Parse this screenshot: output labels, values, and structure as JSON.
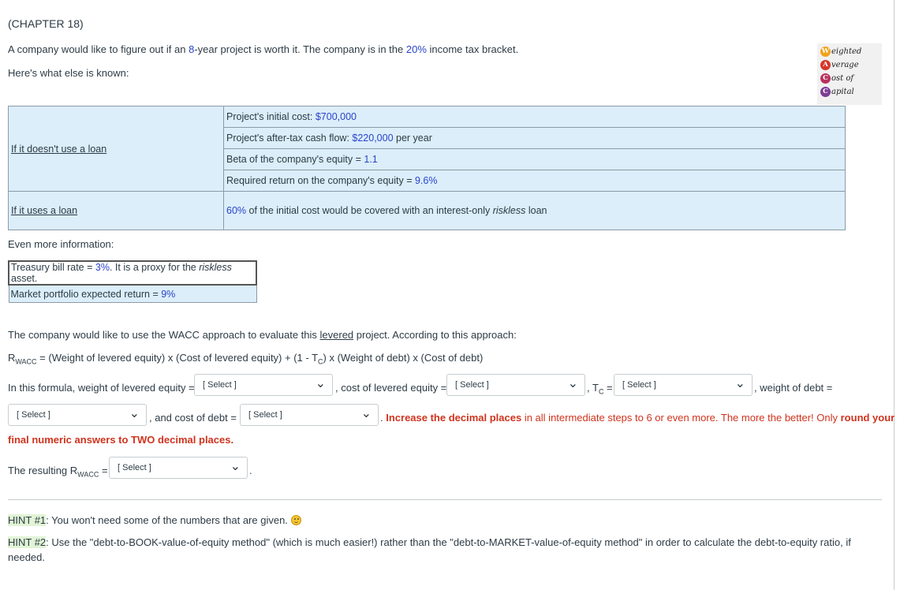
{
  "chapter": "(CHAPTER 18)",
  "intro": {
    "p1_a": "A company would like to figure out if an ",
    "years": "8",
    "p1_b": "-year project is worth it. The company is in the ",
    "tax": "20%",
    "p1_c": " income tax bracket.",
    "p2": "Here's what else is known:"
  },
  "logo": {
    "letters": [
      "W",
      "A",
      "C",
      "C"
    ],
    "words": [
      "eighted",
      "verage",
      "ost of",
      "apital"
    ],
    "colors": [
      "#f2a31b",
      "#d6372b",
      "#b8325f",
      "#7e3c94"
    ]
  },
  "table": {
    "no_loan_label": "If it doesn't use a loan",
    "rows": [
      {
        "pre": "Project's initial cost: ",
        "val": "$700,000",
        "post": ""
      },
      {
        "pre": "Project's after-tax cash flow: ",
        "val": "$220,000",
        "post": " per year"
      },
      {
        "pre": "Beta of the company's equity = ",
        "val": "1.1",
        "post": ""
      },
      {
        "pre": "Required return on the company's equity = ",
        "val": "9.6%",
        "post": ""
      }
    ],
    "loan_label": "If it uses a loan",
    "loan_val": "60%",
    "loan_text": " of the initial cost would be covered with an interest-only ",
    "loan_ital": "riskless",
    "loan_end": " loan"
  },
  "more": {
    "heading": "Even more information:",
    "tbill_pre": "Treasury bill rate = ",
    "tbill_val": "3%",
    "tbill_post": ". It is a proxy for the ",
    "tbill_ital": "riskless",
    "tbill_end": " asset.",
    "market_pre": "Market portfolio expected return = ",
    "market_val": "9%"
  },
  "wacc": {
    "p1_a": "The company would like to use the WACC approach to evaluate this ",
    "levered": "levered",
    "p1_b": " project. According to this approach:",
    "formula_r": "R",
    "formula_sub": "WACC",
    "formula_a": " = (Weight of levered equity) x (Cost of levered equity) + (1 - T",
    "formula_tsub": "C",
    "formula_b": ") x (Weight of debt) x (Cost of debt)",
    "f1": "In this formula, weight of levered equity = ",
    "f2": ", cost of levered equity = ",
    "f3": ", T",
    "f3_sub": "C",
    "f3_eq": " = ",
    "f4": ", weight of debt =",
    "f5": ", and cost of debt = ",
    "f6": ". ",
    "inc": "Increase the decimal places",
    "inc_rest": " in all intermediate steps to 6 or even more. The more the better! Only ",
    "round": "round your",
    "final": "final numeric answers to TWO decimal places.",
    "result_a": "The resulting R",
    "result_sub": "WACC",
    "result_b": " = ",
    "result_end": ".",
    "select_label": "[ Select ]"
  },
  "hints": {
    "h1_label": "HINT #1",
    "h1_text": ": You won't need some of the numbers that are given.",
    "h2_label": "HINT #2",
    "h2_text": ": Use the \"debt-to-BOOK-value-of-equity method\" (which is much easier!) rather than the \"debt-to-MARKET-value-of-equity method\" in order to calculate the debt-to-equity ratio, if",
    "h2_text2": "needed."
  }
}
